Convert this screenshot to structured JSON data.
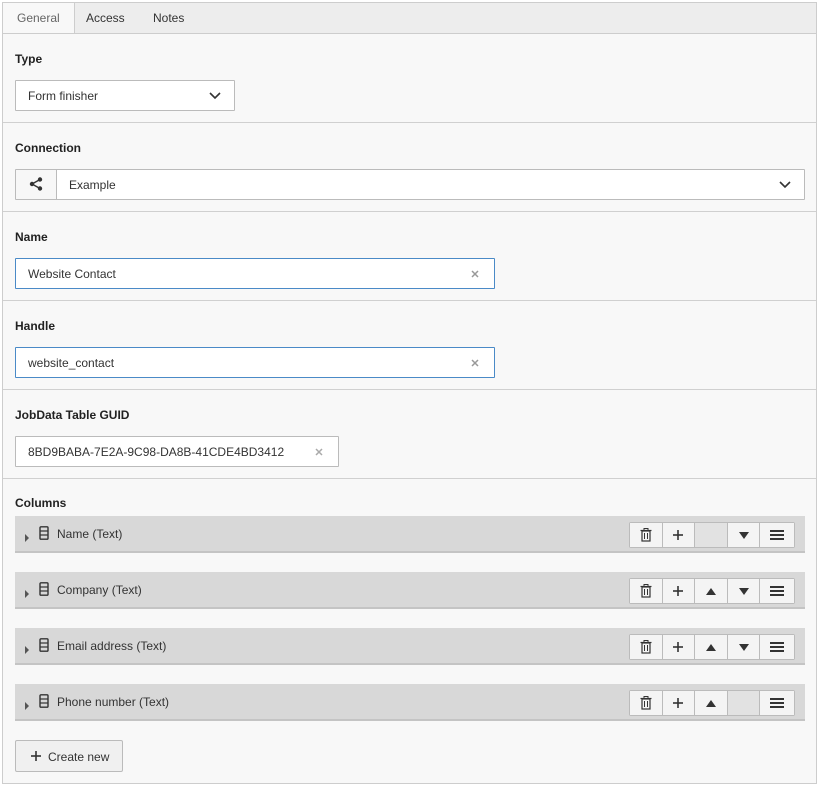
{
  "tabs": [
    {
      "label": "General",
      "active": true
    },
    {
      "label": "Access",
      "active": false
    },
    {
      "label": "Notes",
      "active": false
    }
  ],
  "type": {
    "label": "Type",
    "value": "Form finisher"
  },
  "connection": {
    "label": "Connection",
    "value": "Example",
    "icon": "share-nodes-icon"
  },
  "name": {
    "label": "Name",
    "value": "Website Contact"
  },
  "handle": {
    "label": "Handle",
    "value": "website_contact"
  },
  "guid": {
    "label": "JobData Table GUID",
    "value": "8BD9BABA-7E2A-9C98-DA8B-41CDE4BD3412"
  },
  "columns": {
    "label": "Columns",
    "items": [
      {
        "label": "Name (Text)",
        "can_move_up": false,
        "can_move_down": true
      },
      {
        "label": "Company (Text)",
        "can_move_up": true,
        "can_move_down": true
      },
      {
        "label": "Email address (Text)",
        "can_move_up": true,
        "can_move_down": true
      },
      {
        "label": "Phone number (Text)",
        "can_move_up": true,
        "can_move_down": false
      }
    ],
    "create_label": "Create new"
  },
  "colors": {
    "accent_border": "#4a8ac7",
    "row_bg": "#d8d8d8",
    "panel_bg": "#f8f8f8"
  }
}
